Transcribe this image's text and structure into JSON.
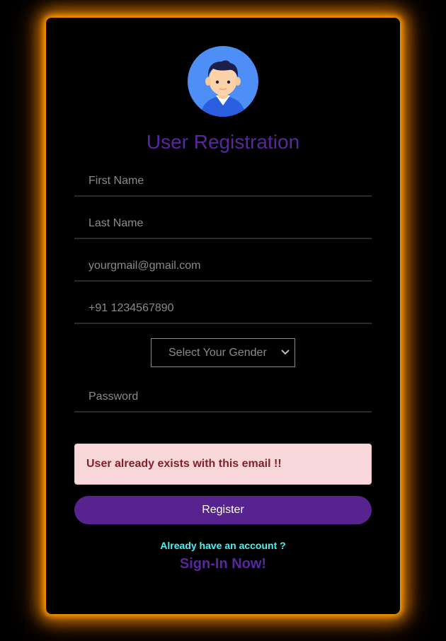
{
  "form": {
    "title": "User Registration",
    "avatar_icon": "user-avatar-icon",
    "first_name_placeholder": "First Name",
    "last_name_placeholder": "Last Name",
    "email_placeholder": "yourgmail@gmail.com",
    "phone_placeholder": "+91 1234567890",
    "gender_selected": "Select Your Gender",
    "password_placeholder": "Password",
    "error_message": "User already exists with this email !!",
    "register_label": "Register",
    "already_text": "Already have an account ?",
    "signin_label": "Sign-In Now!"
  },
  "colors": {
    "glow": "#ff9d00",
    "accent": "#58279d",
    "button": "#57238f",
    "link_cyan": "#4ef0f0",
    "alert_bg": "#f8d7da",
    "alert_text": "#842029"
  }
}
